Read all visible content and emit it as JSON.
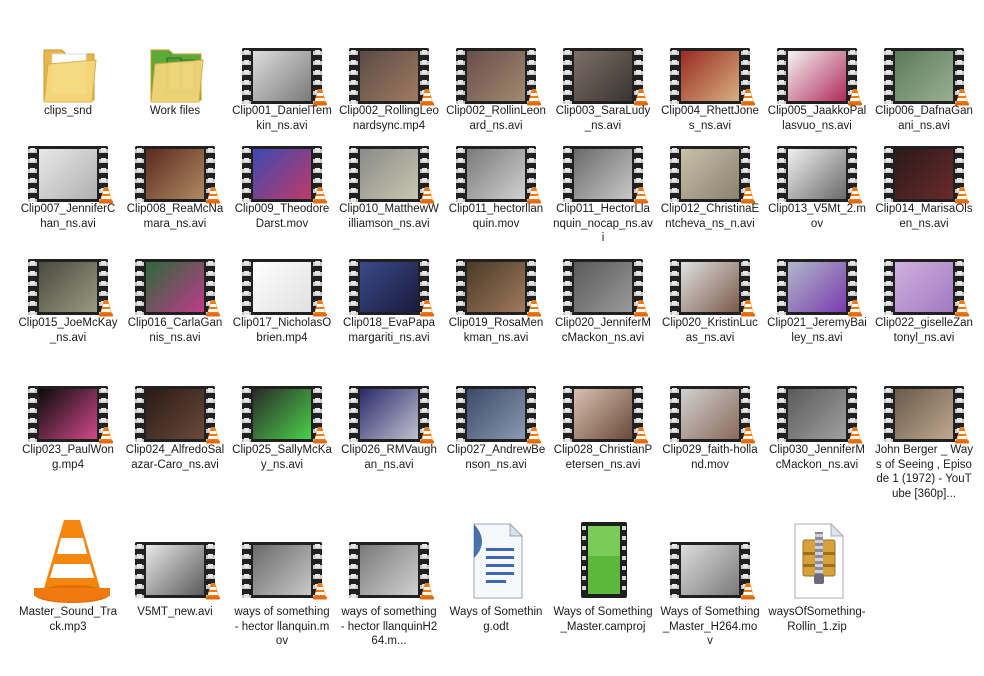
{
  "items": [
    {
      "label": "clips_snd",
      "type": "folder",
      "thumb": [
        "#f5d77a",
        "#e8b64a"
      ]
    },
    {
      "label": "Work files",
      "type": "folder-work",
      "thumb": [
        "#f5d77a",
        "#5caa3a"
      ]
    },
    {
      "label": "Clip001_DanielTemkin_ns.avi",
      "type": "video",
      "thumb": [
        "#dcdcdc",
        "#7a7a7a"
      ]
    },
    {
      "label": "Clip002_RollingLeonardsync.mp4",
      "type": "video",
      "thumb": [
        "#5a4b46",
        "#a07a60"
      ]
    },
    {
      "label": "Clip002_RollinLeonard_ns.avi",
      "type": "video",
      "thumb": [
        "#6a4e4a",
        "#a08a70"
      ]
    },
    {
      "label": "Clip003_SaraLudy_ns.avi",
      "type": "video",
      "thumb": [
        "#7c7068",
        "#3a3430"
      ]
    },
    {
      "label": "Clip004_RhettJones_ns.avi",
      "type": "video",
      "thumb": [
        "#9a2a22",
        "#d6b080"
      ]
    },
    {
      "label": "Clip005_JaakkoPallasvuo_ns.avi",
      "type": "video",
      "thumb": [
        "#f4f4f4",
        "#b02a5a"
      ]
    },
    {
      "label": "Clip006_DafnaGanani_ns.avi",
      "type": "video",
      "thumb": [
        "#5a7a5a",
        "#9ab090"
      ]
    },
    {
      "label": "Clip007_JenniferChan_ns.avi",
      "type": "video",
      "thumb": [
        "#e8e8e8",
        "#b0b0b0"
      ]
    },
    {
      "label": "Clip008_ReaMcNamara_ns.avi",
      "type": "video",
      "thumb": [
        "#5a2a20",
        "#b08a60"
      ]
    },
    {
      "label": "Clip009_TheodoreDarst.mov",
      "type": "video",
      "thumb": [
        "#3a4ab0",
        "#c03a6a"
      ]
    },
    {
      "label": "Clip010_MatthewWilliamson_ns.avi",
      "type": "video",
      "thumb": [
        "#8a8a8a",
        "#c8c8b0"
      ]
    },
    {
      "label": "Clip011_hectorllanquin.mov",
      "type": "video",
      "thumb": [
        "#7a7a7a",
        "#d0d0d0"
      ]
    },
    {
      "label": "Clip011_HectorLlanquin_nocap_ns.avi",
      "type": "video",
      "thumb": [
        "#6a6a6a",
        "#c8c8c8"
      ]
    },
    {
      "label": "Clip012_ChristinaEntcheva_ns_n.avi",
      "type": "video",
      "thumb": [
        "#c8c0a8",
        "#8a8270"
      ]
    },
    {
      "label": "Clip013_V5Mt_2.mov",
      "type": "video",
      "thumb": [
        "#f0f0f0",
        "#6a6a6a"
      ]
    },
    {
      "label": "Clip014_MarisaOlsen_ns.avi",
      "type": "video",
      "thumb": [
        "#2a1a1a",
        "#6a2a2a"
      ]
    },
    {
      "label": "Clip015_JoeMcKay_ns.avi",
      "type": "video",
      "thumb": [
        "#4a4a40",
        "#9a9a80"
      ]
    },
    {
      "label": "Clip016_CarlaGannis_ns.avi",
      "type": "video",
      "thumb": [
        "#2a6a3a",
        "#c03a8a"
      ]
    },
    {
      "label": "Clip017_NicholasObrien.mp4",
      "type": "video",
      "thumb": [
        "#ffffff",
        "#e0e0e0"
      ]
    },
    {
      "label": "Clip018_EvaPapamargariti_ns.avi",
      "type": "video",
      "thumb": [
        "#3a4a8a",
        "#1a1a3a"
      ]
    },
    {
      "label": "Clip019_RosaMenkman_ns.avi",
      "type": "video",
      "thumb": [
        "#4a3a2a",
        "#a07a5a"
      ]
    },
    {
      "label": "Clip020_JenniferMcMackon_ns.avi",
      "type": "video",
      "thumb": [
        "#5a5a5a",
        "#9a9a9a"
      ]
    },
    {
      "label": "Clip020_KristinLucas_ns.avi",
      "type": "video",
      "thumb": [
        "#e0e0e0",
        "#7a5a4a"
      ]
    },
    {
      "label": "Clip021_JeremyBailey_ns.avi",
      "type": "video",
      "thumb": [
        "#b0b8c8",
        "#7a3ab0"
      ]
    },
    {
      "label": "Clip022_giselleZantonyl_ns.avi",
      "type": "video",
      "thumb": [
        "#d0b0e0",
        "#a07ac0"
      ]
    },
    {
      "label": "Clip023_PaulWong.mp4",
      "type": "video",
      "thumb": [
        "#0a0a0a",
        "#d04a8a"
      ]
    },
    {
      "label": "Clip024_AlfredoSalazar-Caro_ns.avi",
      "type": "video",
      "thumb": [
        "#2a1a14",
        "#6a4a3a"
      ]
    },
    {
      "label": "Clip025_SallyMcKay_ns.avi",
      "type": "video",
      "thumb": [
        "#2a2a2a",
        "#4ad04a"
      ]
    },
    {
      "label": "Clip026_RMVaughan_ns.avi",
      "type": "video",
      "thumb": [
        "#2a2a6a",
        "#c0c0d0"
      ]
    },
    {
      "label": "Clip027_AndrewBenson_ns.avi",
      "type": "video",
      "thumb": [
        "#3a4a6a",
        "#8a9ab0"
      ]
    },
    {
      "label": "Clip028_ChristianPetersen_ns.avi",
      "type": "video",
      "thumb": [
        "#d8c0b0",
        "#6a4a3a"
      ]
    },
    {
      "label": "Clip029_faith-holland.mov",
      "type": "video",
      "thumb": [
        "#d0d0d0",
        "#8a6a5a"
      ]
    },
    {
      "label": "Clip030_JenniferMcMackon_ns.avi",
      "type": "video",
      "thumb": [
        "#5a5a5a",
        "#a0a0a0"
      ]
    },
    {
      "label": "John Berger _ Ways of Seeing , Episode 1 (1972) - YouTube [360p]...",
      "type": "video",
      "thumb": [
        "#6a5a4a",
        "#c0a890"
      ]
    },
    {
      "label": "Master_Sound_Track.mp3",
      "type": "vlc"
    },
    {
      "label": "V5MT_new.avi",
      "type": "video",
      "thumb": [
        "#e8e8e8",
        "#5a5a5a"
      ]
    },
    {
      "label": "ways of something - hector llanquin.mov",
      "type": "video",
      "thumb": [
        "#6a6a6a",
        "#c8c8c8"
      ]
    },
    {
      "label": "ways of something - hector llanquinH264.m...",
      "type": "video",
      "thumb": [
        "#7a7a7a",
        "#d0d0d0"
      ]
    },
    {
      "label": "Ways of Something.odt",
      "type": "doc"
    },
    {
      "label": "Ways of Something_Master.camproj",
      "type": "camproj"
    },
    {
      "label": "Ways of Something_Master_H264.mov",
      "type": "video",
      "thumb": [
        "#dcdcdc",
        "#7a7a7a"
      ]
    },
    {
      "label": "waysOfSomething-Rollin_1.zip",
      "type": "zip"
    }
  ]
}
